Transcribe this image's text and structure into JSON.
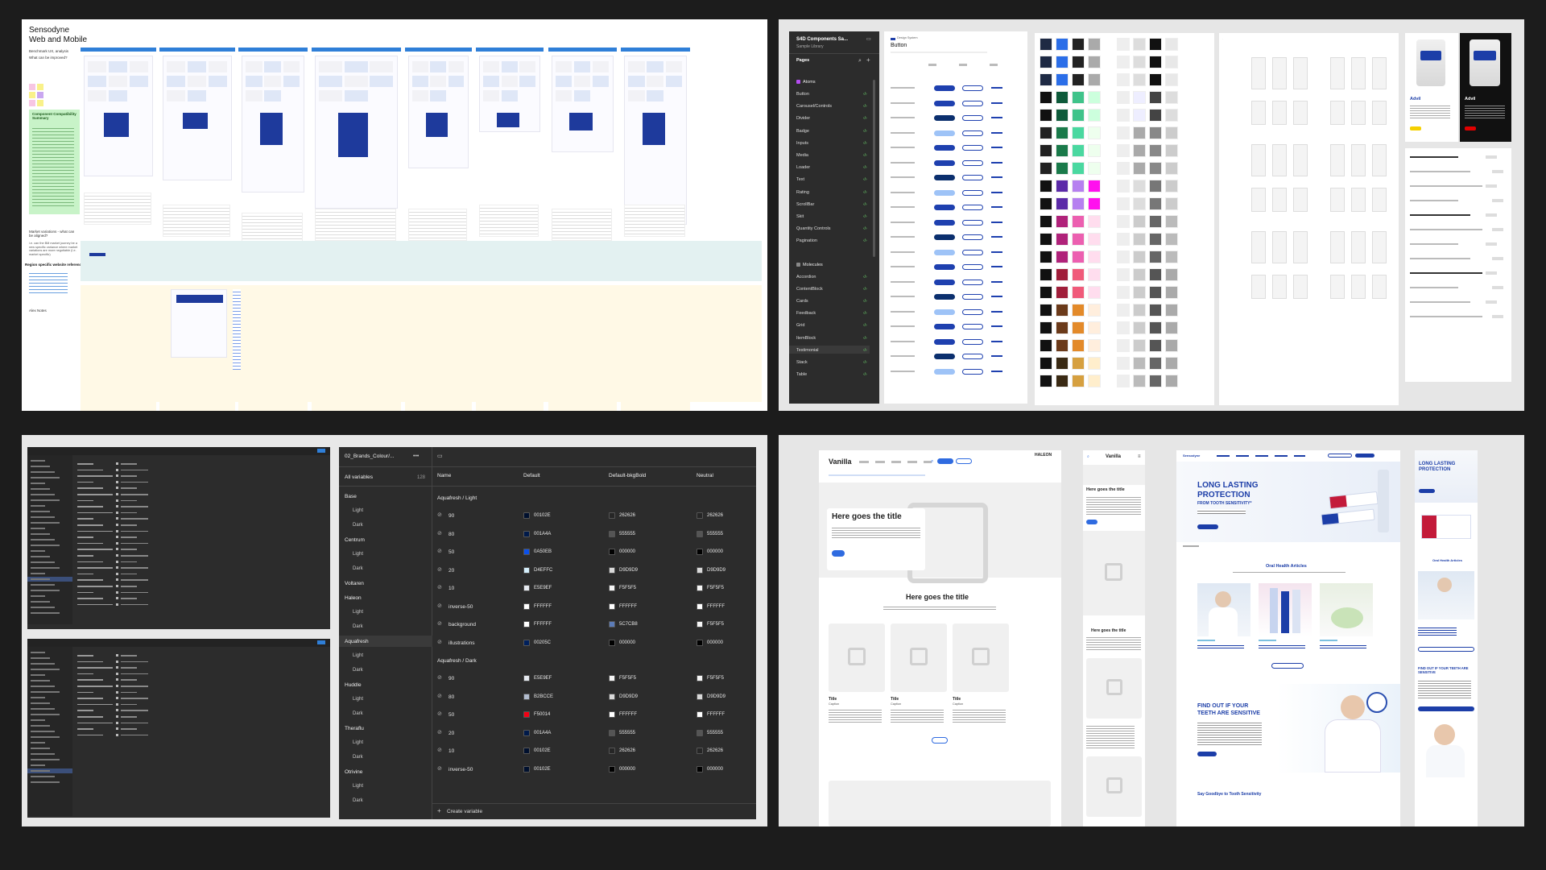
{
  "panel1": {
    "title_line1": "Sensodyne",
    "title_line2": "Web and Mobile",
    "benchmark": "Benchmark UX, analysis",
    "question": "What can be improved?",
    "notes_title": "Component Compatibility Summary",
    "market_variations": "Market variations - what can be aligned?",
    "market_note": "i.e. can the BM market journey be a new specific variance where market variations are more negotiable (I.e. market specific)",
    "region_refs": "Region specific website references",
    "alex_notes": "Alex Notes"
  },
  "panel2": {
    "file_name": "S4D Components Sa...",
    "library_name": "Sample Library",
    "pages_label": "Pages",
    "frame_label": "Design System",
    "frame_title": "Button",
    "sidebar_groups": [
      {
        "name": "Atoms",
        "items": [
          "Button",
          "Carousel/Controls",
          "Divider",
          "Badge",
          "Inputs",
          "Media",
          "Loader",
          "Text",
          "Rating",
          "ScrollBar",
          "Skit",
          "Quantity Controls",
          "Pagination"
        ]
      },
      {
        "name": "Molecules",
        "items": [
          "Accordion",
          "ContentBlock",
          "Cards",
          "Feedback",
          "Grid",
          "ItemBlock",
          "Testimonial",
          "Stack",
          "Table"
        ]
      }
    ],
    "advil_left": "Advil",
    "advil_right": "Advil"
  },
  "panel3": {
    "collection": "02_Brands_Colour/...",
    "all_variables_label": "All variables",
    "all_variables_count": "128",
    "columns": [
      "Name",
      "Default",
      "Default-bkgBold",
      "Neutral"
    ],
    "sidebar": [
      {
        "name": "Base",
        "modes": [
          "Light",
          "Dark"
        ]
      },
      {
        "name": "Centrum",
        "modes": [
          "Light",
          "Dark"
        ]
      },
      {
        "name": "Voltaren",
        "modes": []
      },
      {
        "name": "Haleon",
        "modes": [
          "Light",
          "Dark"
        ]
      },
      {
        "name": "Aquafresh",
        "modes": [
          "Light",
          "Dark"
        ]
      },
      {
        "name": "Huddle",
        "modes": [
          "Light",
          "Dark"
        ]
      },
      {
        "name": "Theraflu",
        "modes": [
          "Light",
          "Dark"
        ]
      },
      {
        "name": "Otrivine",
        "modes": [
          "Light",
          "Dark"
        ]
      }
    ],
    "group_light": "Aquafresh / Light",
    "group_dark": "Aquafresh / Dark",
    "rows_light": [
      {
        "name": "90",
        "default": "00102E",
        "d_color": "#00102e",
        "bold": "262626",
        "b_color": "#262626",
        "neutral": "262626",
        "n_color": "#262626"
      },
      {
        "name": "80",
        "default": "001A4A",
        "d_color": "#001a4a",
        "bold": "555555",
        "b_color": "#555555",
        "neutral": "555555",
        "n_color": "#555555"
      },
      {
        "name": "50",
        "default": "0A50EB",
        "d_color": "#0a50eb",
        "bold": "000000",
        "b_color": "#000000",
        "neutral": "000000",
        "n_color": "#000000"
      },
      {
        "name": "20",
        "default": "D4EFFC",
        "d_color": "#d4effc",
        "bold": "D9D9D9",
        "b_color": "#d9d9d9",
        "neutral": "D9D9D9",
        "n_color": "#d9d9d9"
      },
      {
        "name": "10",
        "default": "E5E9EF",
        "d_color": "#e5e9ef",
        "bold": "F5F5F5",
        "b_color": "#f5f5f5",
        "neutral": "F5F5F5",
        "n_color": "#f5f5f5"
      },
      {
        "name": "inverse-50",
        "default": "FFFFFF",
        "d_color": "#ffffff",
        "bold": "FFFFFF",
        "b_color": "#ffffff",
        "neutral": "FFFFFF",
        "n_color": "#ffffff"
      },
      {
        "name": "background",
        "default": "FFFFFF",
        "d_color": "#ffffff",
        "bold": "5C7CB8",
        "b_color": "#5c7cb8",
        "neutral": "F5F5F5",
        "n_color": "#f5f5f5"
      },
      {
        "name": "illustrations",
        "default": "00205C",
        "d_color": "#00205c",
        "bold": "000000",
        "b_color": "#000000",
        "neutral": "000000",
        "n_color": "#000000"
      }
    ],
    "rows_dark": [
      {
        "name": "90",
        "default": "E5E9EF",
        "d_color": "#e5e9ef",
        "bold": "F5F5F5",
        "b_color": "#f5f5f5",
        "neutral": "F5F5F5",
        "n_color": "#f5f5f5"
      },
      {
        "name": "80",
        "default": "B2BCCE",
        "d_color": "#b2bcce",
        "bold": "D9D9D9",
        "b_color": "#d9d9d9",
        "neutral": "D9D9D9",
        "n_color": "#d9d9d9"
      },
      {
        "name": "50",
        "default": "F50014",
        "d_color": "#f50014",
        "bold": "FFFFFF",
        "b_color": "#ffffff",
        "neutral": "FFFFFF",
        "n_color": "#ffffff"
      },
      {
        "name": "20",
        "default": "001A4A",
        "d_color": "#001a4a",
        "bold": "555555",
        "b_color": "#555555",
        "neutral": "555555",
        "n_color": "#555555"
      },
      {
        "name": "10",
        "default": "00102E",
        "d_color": "#00102e",
        "bold": "262626",
        "b_color": "#262626",
        "neutral": "262626",
        "n_color": "#262626"
      },
      {
        "name": "inverse-50",
        "default": "00102E",
        "d_color": "#00102e",
        "bold": "000000",
        "b_color": "#000000",
        "neutral": "000000",
        "n_color": "#000000"
      }
    ],
    "create_variable": "Create variable"
  },
  "panel4": {
    "logo_vanilla": "Vanilla",
    "logo_haleon": "HALEON",
    "hero_title": "Here goes the title",
    "section_title": "Here goes the title",
    "card_title": "Title",
    "card_caption": "Caption",
    "mobile_logo": "Vanilla",
    "mobile_title": "Here goes the title",
    "mobile_title2": "Here goes the title",
    "senso_hero_line1": "LONG LASTING",
    "senso_hero_line2": "PROTECTION",
    "senso_hero_sub": "FROM TOOTH SENSITIVITY*",
    "articles_title": "Oral Health Articles",
    "find_out_line1": "FIND OUT IF YOUR",
    "find_out_line2": "TEETH ARE SENSITIVE",
    "goodbye": "Say Goodbye to Tooth Sensitivity",
    "m_hero_line1": "LONG LASTING",
    "m_hero_line2": "PROTECTION",
    "m_articles": "Oral Health Articles",
    "m_find_out": "FIND OUT IF YOUR TEETH ARE SENSITIVE",
    "senso_brand": "Sensodyne"
  }
}
